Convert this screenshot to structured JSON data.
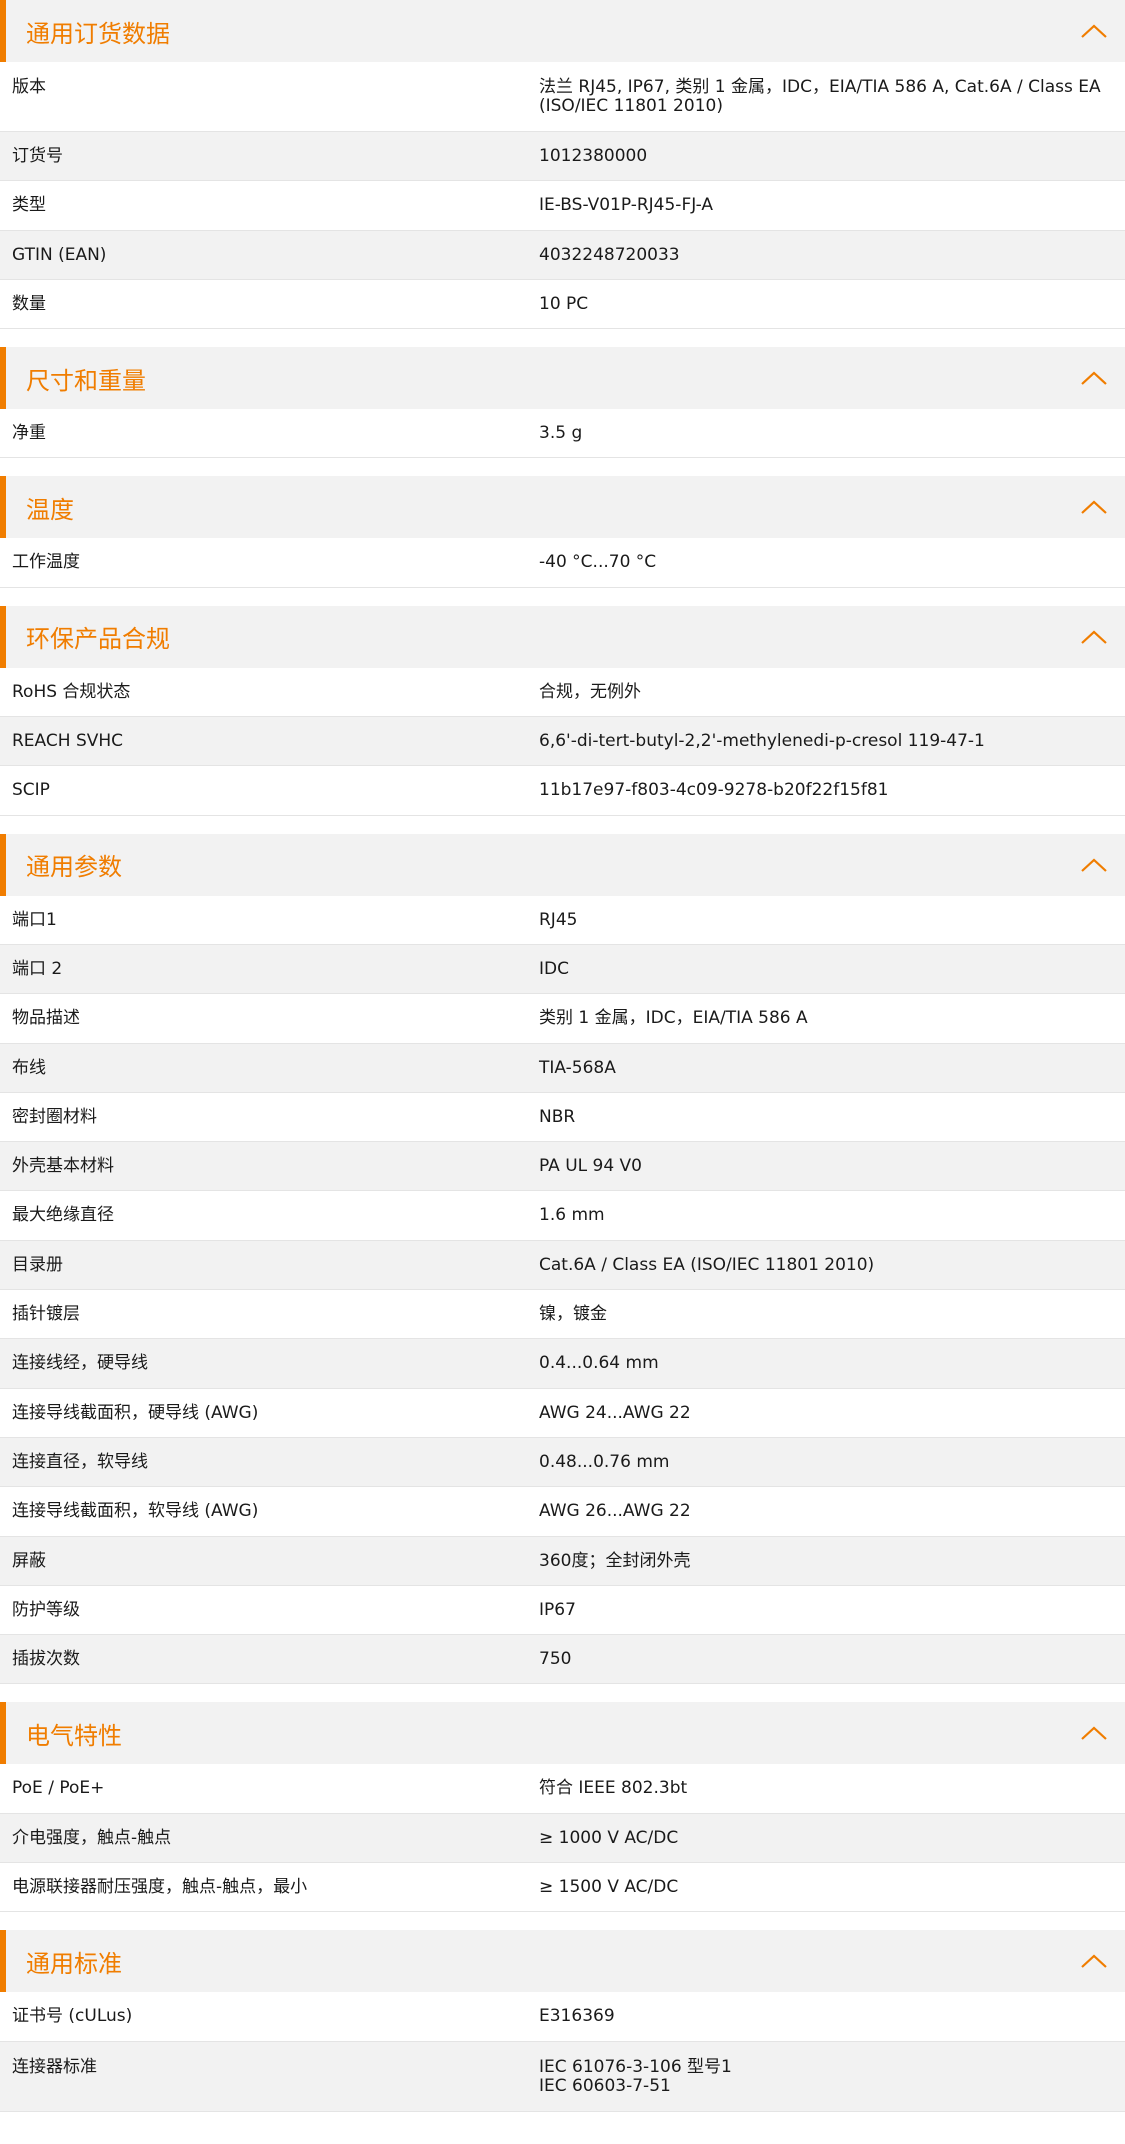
{
  "accent_color": "#f07d00",
  "collapse_icon": "chevron-up-icon",
  "sections": [
    {
      "title": "通用订货数据",
      "rows": [
        {
          "label": "版本",
          "value": "法兰 RJ45, IP67, 类别 1 金属，IDC，EIA/TIA 586 A, Cat.6A / Class EA\n(ISO/IEC 11801 2010)"
        },
        {
          "label": "订货号",
          "value": "1012380000"
        },
        {
          "label": "类型",
          "value": "IE-BS-V01P-RJ45-FJ-A"
        },
        {
          "label": "GTIN (EAN)",
          "value": "4032248720033"
        },
        {
          "label": "数量",
          "value": "10  PC"
        }
      ]
    },
    {
      "title": "尺寸和重量",
      "rows": [
        {
          "label": "净重",
          "value": "3.5  g"
        }
      ]
    },
    {
      "title": "温度",
      "rows": [
        {
          "label": "工作温度",
          "value": "-40 °C...70 °C"
        }
      ]
    },
    {
      "title": "环保产品合规",
      "rows": [
        {
          "label": "RoHS 合规状态",
          "value": "合规，无例外"
        },
        {
          "label": "REACH SVHC",
          "value": "6,6'-di-tert-butyl-2,2'-methylenedi-p-cresol 119-47-1"
        },
        {
          "label": "SCIP",
          "value": "11b17e97-f803-4c09-9278-b20f22f15f81"
        }
      ]
    },
    {
      "title": "通用参数",
      "rows": [
        {
          "label": "端口1",
          "value": "RJ45"
        },
        {
          "label": "端口 2",
          "value": "IDC"
        },
        {
          "label": "物品描述",
          "value": "类别 1 金属，IDC，EIA/TIA 586 A"
        },
        {
          "label": "布线",
          "value": "TIA-568A"
        },
        {
          "label": "密封圈材料",
          "value": "NBR"
        },
        {
          "label": "外壳基本材料",
          "value": "PA UL 94 V0"
        },
        {
          "label": "最大绝缘直径",
          "value": "1.6  mm"
        },
        {
          "label": "目录册",
          "value": "Cat.6A / Class EA (ISO/IEC 11801 2010)"
        },
        {
          "label": "插针镀层",
          "value": "镍，镀金"
        },
        {
          "label": "连接线经，硬导线",
          "value": "0.4...0.64 mm"
        },
        {
          "label": "连接导线截面积，硬导线 (AWG)",
          "value": "AWG 24...AWG 22"
        },
        {
          "label": "连接直径，软导线",
          "value": "0.48...0.76 mm"
        },
        {
          "label": "连接导线截面积，软导线 (AWG)",
          "value": "AWG 26...AWG 22"
        },
        {
          "label": "屏蔽",
          "value": "360度；全封闭外壳"
        },
        {
          "label": "防护等级",
          "value": "IP67"
        },
        {
          "label": "插拔次数",
          "value": "750"
        }
      ]
    },
    {
      "title": "电气特性",
      "rows": [
        {
          "label": "PoE / PoE+",
          "value": "符合 IEEE 802.3bt"
        },
        {
          "label": "介电强度，触点-触点",
          "value": "≥ 1000 V AC/DC"
        },
        {
          "label": "电源联接器耐压强度，触点-触点，最小",
          "value": "≥ 1500 V AC/DC"
        }
      ]
    },
    {
      "title": "通用标准",
      "rows": [
        {
          "label": "证书号 (cULus)",
          "value": "E316369"
        },
        {
          "label": "连接器标准",
          "value": "IEC 61076-3-106 型号1\nIEC 60603-7-51"
        }
      ]
    }
  ]
}
